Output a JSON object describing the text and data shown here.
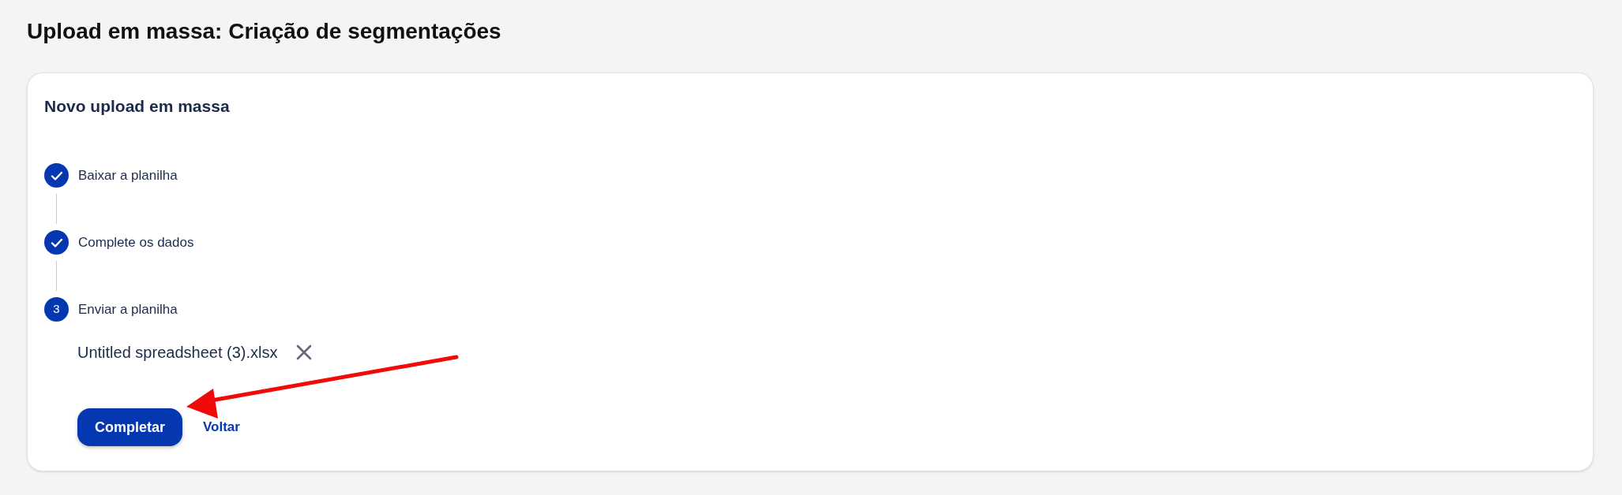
{
  "page_title": "Upload em massa: Criação de segmentações",
  "card": {
    "title": "Novo upload em massa",
    "steps": [
      {
        "label": "Baixar a planilha",
        "completed": true
      },
      {
        "label": "Complete os dados",
        "completed": true
      },
      {
        "label": "Enviar a planilha",
        "completed": false,
        "number": "3"
      }
    ],
    "file": {
      "name": "Untitled spreadsheet (3).xlsx"
    },
    "buttons": [
      {
        "label": "Completar",
        "kind": "primary"
      },
      {
        "label": "Voltar",
        "kind": "link"
      }
    ]
  },
  "annotations": [
    {
      "kind": "arrow"
    }
  ]
}
